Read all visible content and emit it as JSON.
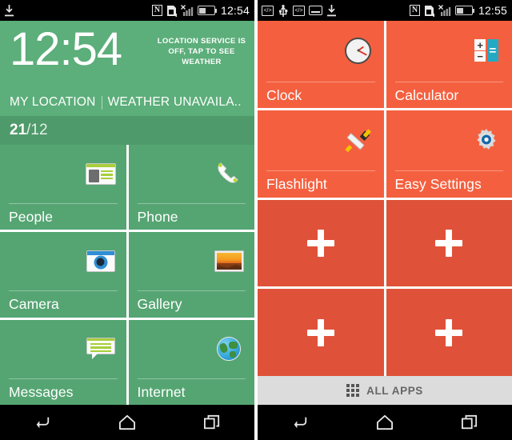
{
  "phones": [
    {
      "id": "left-phone",
      "theme_color": "#55a572",
      "statusbar": {
        "time": "12:54",
        "left_icons": [
          "download-icon"
        ],
        "right_icons": [
          "nfc-icon",
          "sim-card-icon",
          "signal-no-service-icon",
          "battery-charging-icon"
        ]
      },
      "widget": {
        "clock": "12:54",
        "note": "LOCATION SERVICE IS OFF, TAP TO SEE WEATHER",
        "location": "MY LOCATION",
        "weather": "WEATHER UNAVAILA..",
        "date_day": "21",
        "date_month": "/12"
      },
      "tiles": [
        {
          "label": "People",
          "icon": "contacts-icon"
        },
        {
          "label": "Phone",
          "icon": "phone-handset-icon"
        },
        {
          "label": "Camera",
          "icon": "camera-icon"
        },
        {
          "label": "Gallery",
          "icon": "gallery-icon"
        },
        {
          "label": "Messages",
          "icon": "messages-icon"
        },
        {
          "label": "Internet",
          "icon": "globe-icon"
        }
      ],
      "navbar": [
        "back-button",
        "home-button",
        "recents-button"
      ]
    },
    {
      "id": "right-phone",
      "theme_color": "#f4603f",
      "statusbar": {
        "time": "12:55",
        "left_icons": [
          "developer-icon",
          "usb-icon",
          "developer-icon",
          "keyboard-icon",
          "download-icon"
        ],
        "right_icons": [
          "nfc-icon",
          "sim-card-icon",
          "signal-no-service-icon",
          "battery-charging-icon"
        ]
      },
      "tiles": [
        {
          "label": "Clock",
          "icon": "analog-clock-icon"
        },
        {
          "label": "Calculator",
          "icon": "calculator-icon"
        },
        {
          "label": "Flashlight",
          "icon": "flashlight-icon"
        },
        {
          "label": "Easy Settings",
          "icon": "gear-icon"
        },
        {
          "label": "",
          "icon": "plus-icon"
        },
        {
          "label": "",
          "icon": "plus-icon"
        },
        {
          "label": "",
          "icon": "plus-icon"
        },
        {
          "label": "",
          "icon": "plus-icon"
        }
      ],
      "all_apps": {
        "label": "ALL APPS",
        "icon": "grid-dots-icon"
      },
      "navbar": [
        "back-button",
        "home-button",
        "recents-button"
      ]
    }
  ],
  "calculator_keys": {
    "plus": "+",
    "minus": "−",
    "equals": "="
  }
}
